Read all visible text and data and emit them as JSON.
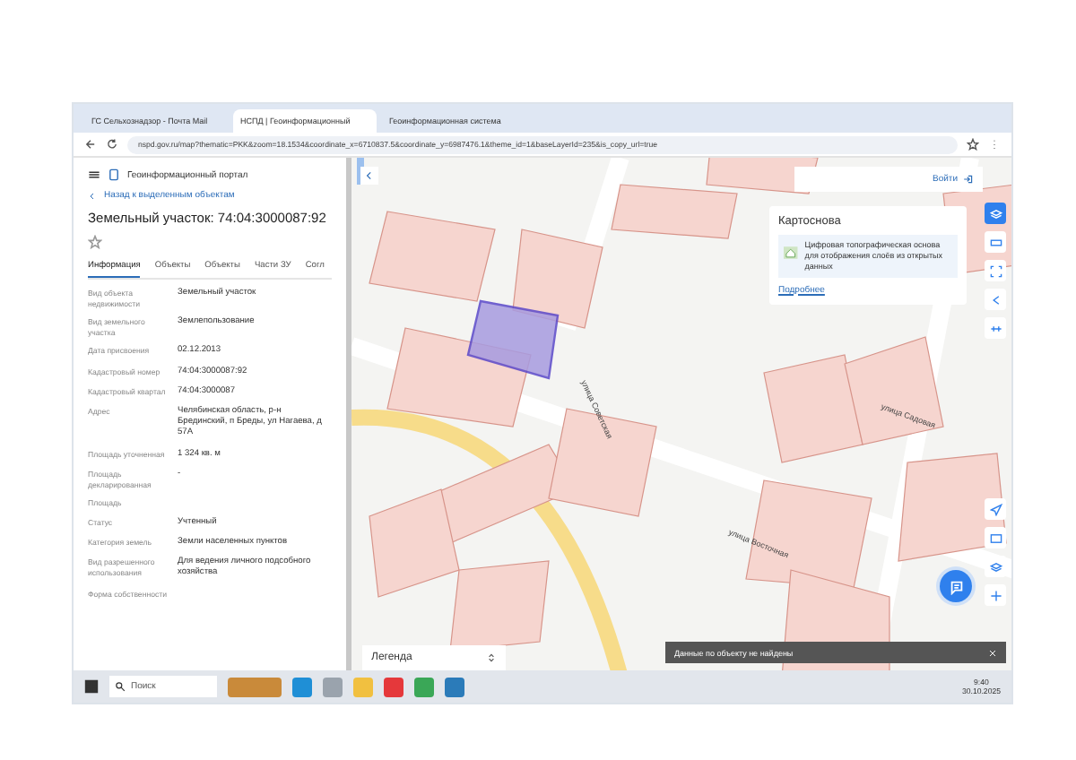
{
  "browser": {
    "tabs": [
      {
        "label": "ГС Сельхознадзор - Почта Mail",
        "selected": false
      },
      {
        "label": "НСПД | Геоинформационный",
        "selected": true
      },
      {
        "label": "Геоинформационная система",
        "selected": false
      }
    ],
    "url": "nspd.gov.ru/map?thematic=PKK&zoom=18.1534&coordinate_x=6710837.5&coordinate_y=6987476.1&theme_id=1&baseLayerId=235&is_copy_url=true"
  },
  "sidebar": {
    "title": "Геоинформационный портал",
    "back_link": "Назад к выделенным объектам",
    "heading": "Земельный участок: 74:04:3000087:92",
    "favorite": false,
    "tabs": [
      {
        "label": "Информация",
        "selected": true
      },
      {
        "label": "Объекты",
        "selected": false
      },
      {
        "label": "Объекты",
        "selected": false
      },
      {
        "label": "Части ЗУ",
        "selected": false
      },
      {
        "label": "Согл",
        "selected": false
      }
    ],
    "fields": [
      {
        "label": "Вид объекта недвижимости",
        "value": "Земельный участок"
      },
      {
        "label": "Вид земельного участка",
        "value": "Землепользование"
      },
      {
        "label": "Дата присвоения",
        "value": "02.12.2013"
      },
      {
        "label": "Кадастровый номер",
        "value": "74:04:3000087:92"
      },
      {
        "label": "Кадастровый квартал",
        "value": "74:04:3000087"
      },
      {
        "label": "Адрес",
        "value": "Челябинская область, р-н Брединский, п Бреды, ул Нагаева, д 57А"
      },
      {
        "label": "Площадь уточненная",
        "value": "1 324 кв. м"
      },
      {
        "label": "Площадь декларированная",
        "value": "-"
      },
      {
        "label": "Площадь"
      },
      {
        "label": "Статус",
        "value": "Учтенный"
      },
      {
        "label": "Категория земель",
        "value": "Земли населенных пунктов"
      },
      {
        "label": "Вид разрешенного использования",
        "value": "Для ведения личного подсобного хозяйства"
      },
      {
        "label": "Форма собственности"
      }
    ]
  },
  "map": {
    "login": "Войти",
    "card": {
      "title": "Картоснова",
      "description": "Цифровая топографическая основа для отображения слоёв из открытых данных",
      "link": "Подробнее"
    },
    "street_labels": [
      "улица Советская",
      "улица Садовая",
      "улица Восточная"
    ],
    "legend": "Легенда",
    "toast": "Данные по объекту не найдены"
  },
  "taskbar": {
    "search_placeholder": "Поиск",
    "time": "9:40",
    "date": "30.10.2025"
  }
}
